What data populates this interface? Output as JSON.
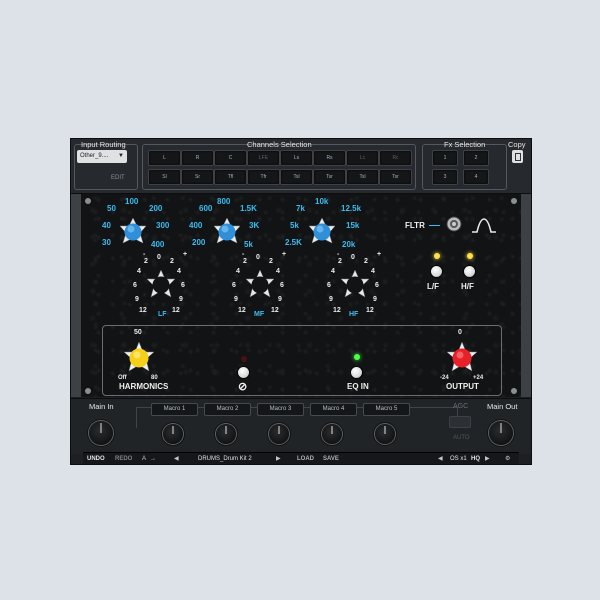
{
  "top": {
    "input_routing_label": "Input Routing",
    "input_routing_value": "Other_9....",
    "edit_label": "EDIT",
    "channels_label": "Channels Selection",
    "channels_row1": [
      "L",
      "R",
      "C",
      "LFE",
      "Ls",
      "Rs",
      "Lc",
      "Rc"
    ],
    "channels_row2": [
      "Sl",
      "Sr",
      "Tfl",
      "Tfr",
      "Tsl",
      "Tsr",
      "Tsl",
      "Tsr"
    ],
    "fx_label": "Fx Selection",
    "fx_buttons": [
      "1",
      "2",
      "3",
      "4"
    ],
    "copy_label": "Copy"
  },
  "eq": {
    "lf_freq_ticks": [
      "100",
      "50",
      "200",
      "40",
      "300",
      "30",
      "400"
    ],
    "mf_freq_ticks": [
      "800",
      "600",
      "1.5K",
      "400",
      "3K",
      "200",
      "5k"
    ],
    "hf_freq_ticks": [
      "10k",
      "7k",
      "12.5k",
      "5k",
      "15k",
      "2.5K",
      "20k"
    ],
    "gain_ticks": [
      "0",
      "2",
      "2",
      "4",
      "4",
      "6",
      "6",
      "9",
      "9",
      "12",
      "12"
    ],
    "minus": "-",
    "plus": "+",
    "lf_label": "LF",
    "mf_label": "MF",
    "hf_label": "HF",
    "fltr_label": "FLTR",
    "lf_shelf_symbol": "L/F",
    "hf_shelf_symbol": "H/F"
  },
  "section": {
    "harmonics_label": "HARMONICS",
    "harmonics_top": "50",
    "harmonics_off": "Off",
    "harmonics_max": "80",
    "phase_symbol": "⊘",
    "eq_in_label": "EQ IN",
    "output_label": "OUTPUT",
    "output_top": "0",
    "output_min": "-24",
    "output_max": "+24"
  },
  "bottom": {
    "main_in_label": "Main In",
    "macros": [
      "Macro 1",
      "Macro 2",
      "Macro 3",
      "Macro 4",
      "Macro 5"
    ],
    "agc_label": "AGC",
    "auto_label": "AUTO",
    "main_out_label": "Main Out"
  },
  "status": {
    "undo": "UNDO",
    "redo": "REDO",
    "a_label": "A",
    "preset_name": "DRUMS_Drum Kit 2",
    "load": "LOAD",
    "save": "SAVE",
    "os_label": "OS x1",
    "hq_label": "HQ"
  },
  "colors": {
    "accent_blue": "#3cbcf0",
    "harmonics_knob": "#f6cf18",
    "output_knob": "#e8202a",
    "led_yellow": "#ffe14a",
    "led_green": "#4cff4a"
  }
}
